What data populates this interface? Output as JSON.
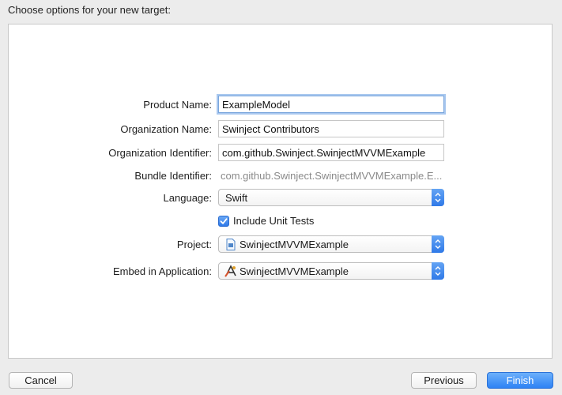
{
  "header": {
    "title": "Choose options for your new target:"
  },
  "form": {
    "product_name": {
      "label": "Product Name:",
      "value": "ExampleModel"
    },
    "organization_name": {
      "label": "Organization Name:",
      "value": "Swinject Contributors"
    },
    "organization_identifier": {
      "label": "Organization Identifier:",
      "value": "com.github.Swinject.SwinjectMVVMExample"
    },
    "bundle_identifier": {
      "label": "Bundle Identifier:",
      "value": "com.github.Swinject.SwinjectMVVMExample.E..."
    },
    "language": {
      "label": "Language:",
      "value": "Swift"
    },
    "include_unit_tests": {
      "label": "Include Unit Tests",
      "checked": true
    },
    "project": {
      "label": "Project:",
      "value": "SwinjectMVVMExample",
      "icon": "project-file-icon"
    },
    "embed_in_application": {
      "label": "Embed in Application:",
      "value": "SwinjectMVVMExample",
      "icon": "app-icon"
    }
  },
  "buttons": {
    "cancel": "Cancel",
    "previous": "Previous",
    "finish": "Finish"
  },
  "colors": {
    "accent": "#2e82f4",
    "focus_ring": "#a9c8ef"
  }
}
